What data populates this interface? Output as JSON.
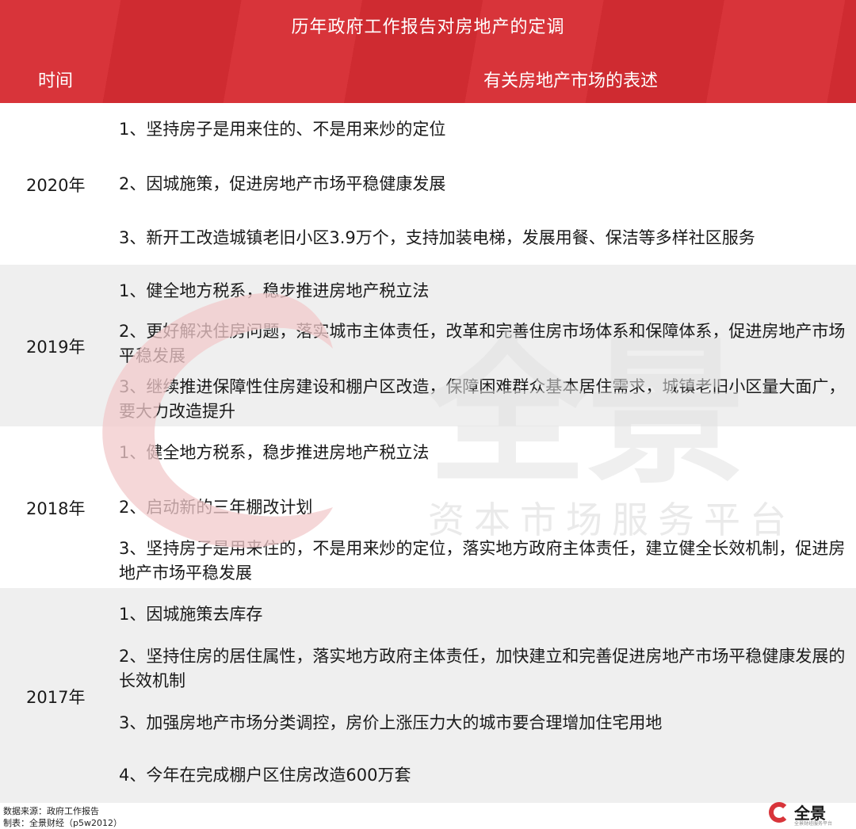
{
  "header": {
    "title": "历年政府工作报告对房地产的定调",
    "col_time": "时间",
    "col_desc": "有关房地产市场的表述"
  },
  "watermark": {
    "brand": "全景",
    "tagline": "资本市场服务平台"
  },
  "rows": [
    {
      "year": "2020年",
      "items": [
        "1、坚持房子是用来住的、不是用来炒的定位",
        "2、因城施策，促进房地产市场平稳健康发展",
        "3、新开工改造城镇老旧小区3.9万个，支持加装电梯，发展用餐、保洁等多样社区服务"
      ]
    },
    {
      "year": "2019年",
      "items": [
        "1、健全地方税系，稳步推进房地产税立法",
        "2、更好解决住房问题，落实城市主体责任，改革和完善住房市场体系和保障体系，促进房地产市场平稳发展",
        "3、继续推进保障性住房建设和棚户区改造，保障困难群众基本居住需求，城镇老旧小区量大面广，要大力改造提升"
      ]
    },
    {
      "year": "2018年",
      "items": [
        "1、健全地方税系，稳步推进房地产税立法",
        "2、启动新的三年棚改计划",
        "3、坚持房子是用来住的，不是用来炒的定位，落实地方政府主体责任，建立健全长效机制，促进房地产市场平稳发展"
      ]
    },
    {
      "year": "2017年",
      "items": [
        "1、因城施策去库存",
        "2、坚持住房的居住属性，落实地方政府主体责任，加快建立和完善促进房地产市场平稳健康发展的长效机制",
        "3、加强房地产市场分类调控，房价上涨压力大的城市要合理增加住宅用地",
        "4、今年在完成棚户区住房改造600万套"
      ]
    }
  ],
  "footer": {
    "source": "数据来源：政府工作报告",
    "maker": "制表：全景财经（p5w2012）"
  },
  "logo": {
    "brand": "全景",
    "sub": "全景财经服务平台"
  },
  "colors": {
    "header_red": "#d8343a",
    "row_shade": "#efefef",
    "watermark_red": "#f2c9cb",
    "watermark_gray": "#e2e2e2"
  }
}
